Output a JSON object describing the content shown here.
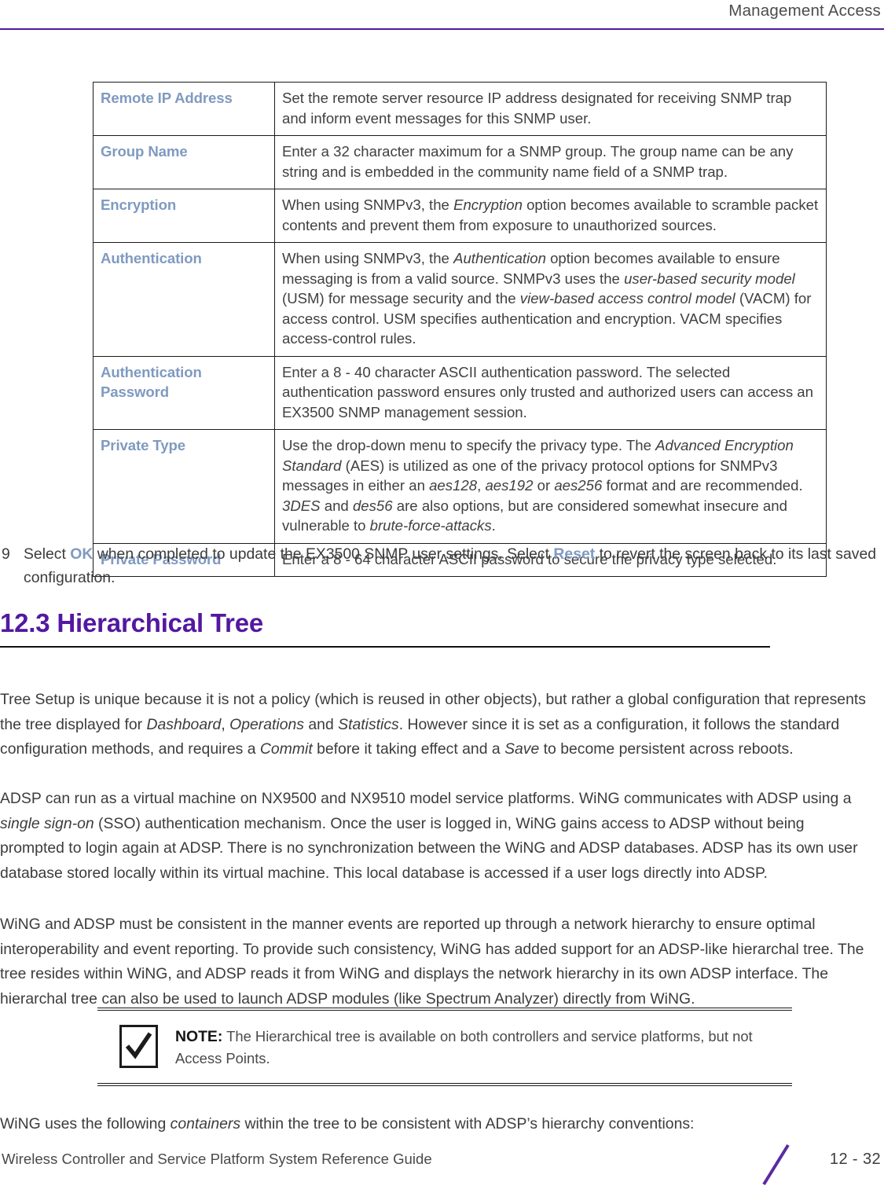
{
  "header": {
    "title": "Management Access",
    "rule_color": "#4f1a9c"
  },
  "param_table": {
    "rows": [
      {
        "label": "Remote IP Address",
        "desc_html": "Set the remote server resource IP address designated for receiving SNMP trap and inform event messages for this SNMP user."
      },
      {
        "label": "Group Name",
        "desc_html": "Enter a 32 character maximum for a SNMP group. The group name can be any string and is embedded in the community name field of a SNMP trap."
      },
      {
        "label": "Encryption",
        "desc_html": "When using SNMPv3, the <i>Encryption</i> option becomes available to scramble packet contents and prevent them from exposure to unauthorized sources."
      },
      {
        "label": "Authentication",
        "desc_html": "When using SNMPv3, the <i>Authentication</i> option becomes available to ensure messaging is from a valid source. SNMPv3 uses the <i>user-based security model</i> (USM) for message security and the <i>view-based access control model</i> (VACM) for access control. USM specifies authentication and encryption. VACM specifies access-control rules."
      },
      {
        "label": "Authentication Password",
        "desc_html": "Enter a 8 - 40 character ASCII authentication password. The selected authentication password ensures only trusted and authorized users can access an EX3500 SNMP management session."
      },
      {
        "label": "Private Type",
        "desc_html": "Use the drop-down menu to specify the privacy type. The <i>Advanced Encryption Standard</i> (AES) is utilized as one of the privacy protocol options for SNMPv3 messages in either an <i>aes128</i>, <i>aes192</i> or <i>aes256</i> format and are recommended. <i>3DES</i> and <i>des56</i> are also options, but are considered somewhat insecure and vulnerable to <i>brute-force-attacks</i>."
      },
      {
        "label": "Private Password",
        "desc_html": "Enter a 8 - 64 character ASCII password to secure the privacy type selected."
      }
    ],
    "label_color": "#7f9ac0"
  },
  "step": {
    "number": "9",
    "text_html": "Select <b class=\"ui-ref\">OK</b> when completed to update the EX3500 SNMP user settings. Select <b class=\"ui-ref\">Reset</b> to revert the screen back to its last saved configuration.",
    "ok_label": "OK",
    "reset_label": "Reset"
  },
  "section": {
    "heading": "12.3 Hierarchical Tree",
    "heading_color": "#5318a0"
  },
  "paragraphs": {
    "p1_html": "Tree Setup is unique because it is not a policy (which is reused in other objects), but rather a global configuration that represents the tree displayed for <i>Dashboard</i>, <i>Operations</i> and <i>Statistics</i>. However since it is set as a configuration, it follows the standard configuration methods, and requires a <i>Commit</i> before it taking effect and a <i>Save</i> to become persistent across reboots.",
    "p2_html": "ADSP can run as a virtual machine on NX9500 and NX9510 model service platforms. WiNG communicates with ADSP using a <i>single sign-on</i> (SSO) authentication mechanism. Once the user is logged in, WiNG gains access to ADSP without being prompted to login again at ADSP. There is no synchronization between the WiNG and ADSP databases. ADSP has its own user database stored locally within its virtual machine. This local database is accessed if a user logs directly into ADSP.",
    "p3_html": "WiNG and ADSP must be consistent in the manner events are reported up through a network hierarchy to ensure optimal interoperability and event reporting. To provide such consistency, WiNG has added support for an ADSP-like hierarchal tree. The tree resides within WiNG, and ADSP reads it from WiNG and displays the network hierarchy in its own ADSP interface. The hierarchal tree can also be used to launch ADSP modules (like Spectrum Analyzer) directly from WiNG.",
    "p4_html": "WiNG uses the following <i>containers</i> within the tree to be consistent with ADSP’s hierarchy conventions:"
  },
  "note": {
    "label": "NOTE:",
    "text": "The Hierarchical tree is available on both controllers and service platforms, but not Access Points.",
    "icon": "checkmark-icon"
  },
  "footer": {
    "guide_title": "Wireless Controller and Service Platform System Reference Guide",
    "page_number": "12 - 32",
    "slash_color": "#5a2ba0"
  }
}
